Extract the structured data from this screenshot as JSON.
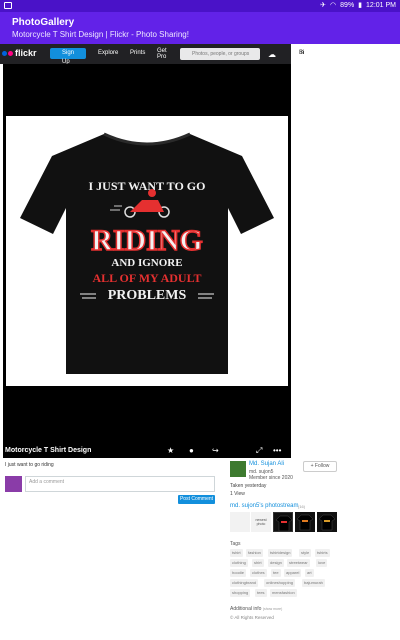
{
  "status_bar": {
    "battery": "89%",
    "time": "12:01 PM"
  },
  "app_bar": {
    "title": "PhotoGallery",
    "subtitle": "Motorcycle T Shirt Design | Flickr - Photo Sharing!"
  },
  "flickr_nav": {
    "logo": "flickr",
    "signup_line1": "Sign",
    "signup_line2": "Up",
    "items": [
      "Explore",
      "Prints",
      "Get",
      "Pro"
    ],
    "search_placeholder": "Photos, people, or groups",
    "right_line1": "Si",
    "right_line2": "In"
  },
  "photo": {
    "caption": "Motorcycle T Shirt Design",
    "shirt_text": {
      "line1": "I JUST WANT TO GO",
      "line2": "RIDING",
      "line3": "AND IGNORE",
      "line4": "ALL OF MY ADULT",
      "line5": "PROBLEMS"
    }
  },
  "description": "I just want to go riding",
  "comment": {
    "placeholder": "Add a comment",
    "post_label": "Post Comment"
  },
  "owner": {
    "name": "Md. Sujan Ali",
    "handle": "md. sujon5",
    "member_since": "Member since 2020",
    "follow_label": "Follow"
  },
  "stats": {
    "taken": "Taken yesterday",
    "views": "1 View"
  },
  "photostream": {
    "title": "md. sujon5's photostream",
    "count": "(16)",
    "thumb_label": "newest photo"
  },
  "tags": {
    "title": "Tags",
    "items": [
      "tshirt",
      "fashion",
      "tshirtdesign",
      "style",
      "tshirts",
      "clothing",
      "shirt",
      "design",
      "streetwear",
      "love",
      "hoodie",
      "clothes",
      "tee",
      "apparel",
      "art",
      "clothingbrand",
      "onlineshopping",
      "bajumurah",
      "shopping",
      "tees",
      "mensfashion"
    ]
  },
  "additional_info": {
    "title": "Additional info",
    "note": "(show more)",
    "rights": "All Rights Reserved"
  },
  "colors": {
    "accent": "#6222e8",
    "flickr_blue": "#128fdc",
    "shirt_red": "#e53030"
  }
}
